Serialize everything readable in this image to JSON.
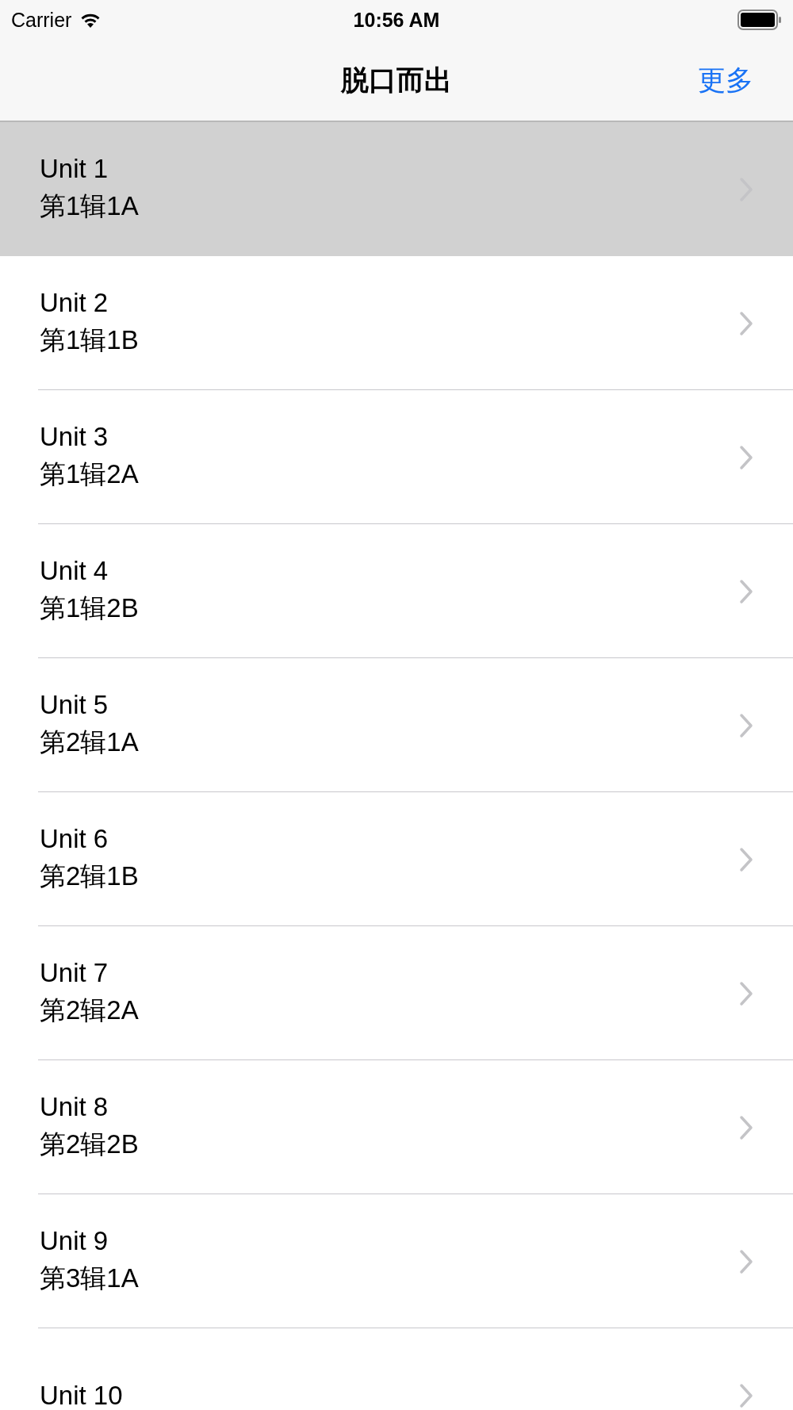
{
  "status_bar": {
    "carrier": "Carrier",
    "time": "10:56 AM"
  },
  "nav_bar": {
    "title": "脱口而出",
    "right_button": "更多"
  },
  "rows": [
    {
      "title": "Unit 1",
      "subtitle": "第1辑1A",
      "selected": true
    },
    {
      "title": "Unit 2",
      "subtitle": "第1辑1B",
      "selected": false
    },
    {
      "title": "Unit 3",
      "subtitle": "第1辑2A",
      "selected": false
    },
    {
      "title": "Unit 4",
      "subtitle": "第1辑2B",
      "selected": false
    },
    {
      "title": "Unit 5",
      "subtitle": "第2辑1A",
      "selected": false
    },
    {
      "title": "Unit 6",
      "subtitle": "第2辑1B",
      "selected": false
    },
    {
      "title": "Unit 7",
      "subtitle": "第2辑2A",
      "selected": false
    },
    {
      "title": "Unit 8",
      "subtitle": "第2辑2B",
      "selected": false
    },
    {
      "title": "Unit 9",
      "subtitle": "第3辑1A",
      "selected": false
    },
    {
      "title": "Unit 10",
      "selected": false
    }
  ]
}
